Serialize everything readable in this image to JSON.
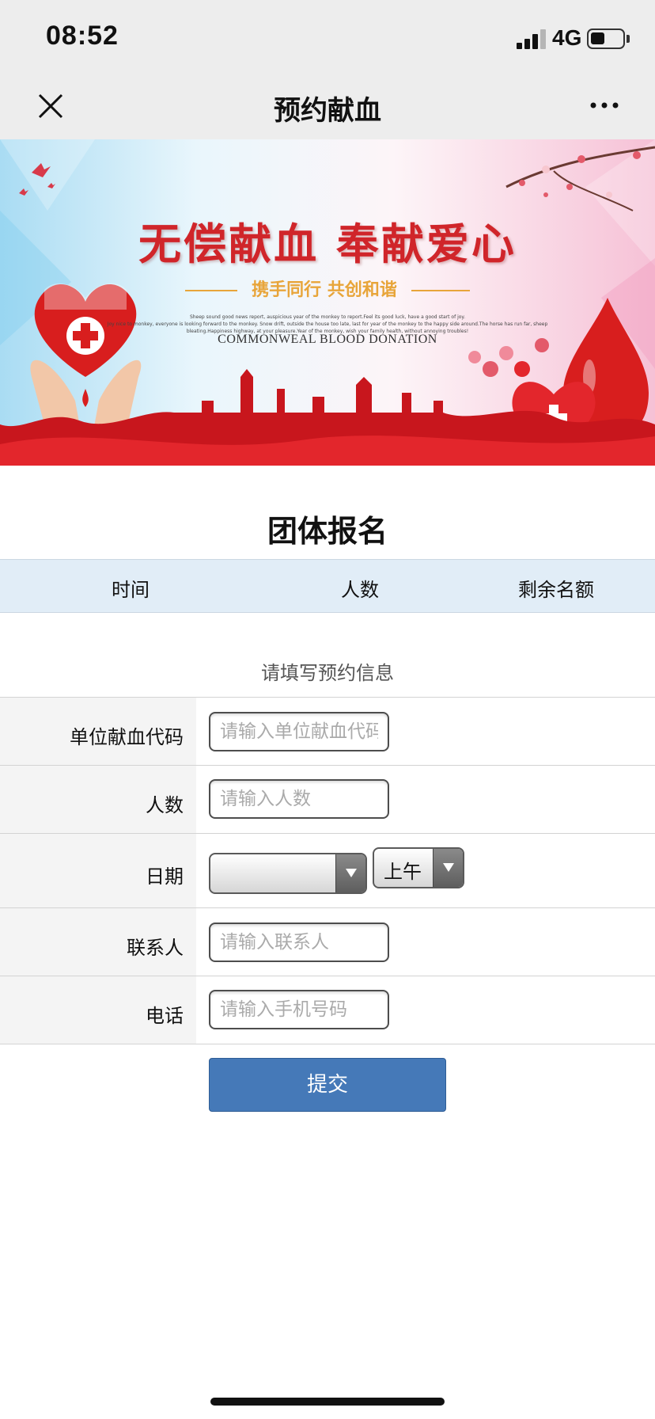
{
  "status_bar": {
    "time": "08:52",
    "network": "4G",
    "battery_level": 0.45
  },
  "nav": {
    "title": "预约献血",
    "close_icon": "close-icon",
    "more_icon": "more-icon"
  },
  "banner": {
    "title": "无偿献血  奉献爱心",
    "subtitle": "携手同行 共创和谐",
    "small_text_1": "Sheep sound good news report, auspicious year of the monkey to report.Feel its good luck, have a good start of joy.",
    "small_text_2": "Joy nice to monkey, everyone is looking forward to the monkey.  Snow drift, outside the house too late, last for year of the monkey to the happy side around.The horse has run far, sheep",
    "small_text_3": "bleating.Happiness highway, at your pleasure.Year of the monkey, wish your family health, without annoying troubles!",
    "english": "COMMONWEAL BLOOD DONATION",
    "colors": {
      "title": "#d0252a",
      "subtitle": "#e8a53a",
      "blood": "#d81e1e"
    }
  },
  "section": {
    "title": "团体报名"
  },
  "table": {
    "headers": [
      "时间",
      "人数",
      "剩余名额"
    ]
  },
  "form": {
    "caption": "请填写预约信息",
    "unit_code": {
      "label": "单位献血代码",
      "placeholder": "请输入单位献血代码"
    },
    "count": {
      "label": "人数",
      "placeholder": "请输入人数"
    },
    "date": {
      "label": "日期",
      "value": "",
      "period": "上午"
    },
    "contact": {
      "label": "联系人",
      "placeholder": "请输入联系人"
    },
    "phone": {
      "label": "电话",
      "placeholder": "请输入手机号码"
    },
    "submit_label": "提交"
  },
  "colors": {
    "nav_bg": "#ededed",
    "table_header_bg": "#e1edf7",
    "submit_bg": "#4579b8",
    "label_bg": "#f4f4f4"
  }
}
